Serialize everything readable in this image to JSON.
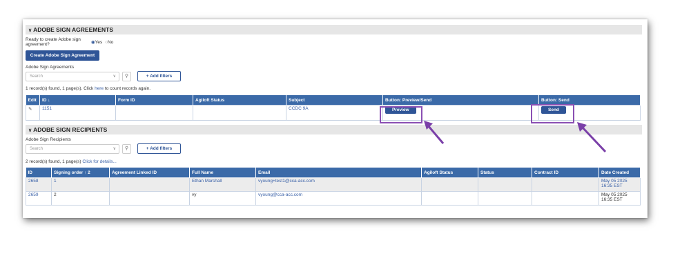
{
  "agreements": {
    "heading": "ADOBE SIGN AGREEMENTS",
    "ready_question": "Ready to create Adobe sign agreement?",
    "ready_options": {
      "yes": "Yes",
      "no": "No"
    },
    "create_button": "Create Adobe Sign Agreement",
    "list_label": "Adobe Sign Agreements",
    "search_placeholder": "Search",
    "add_filters": "+ Add filters",
    "records_text": "1 record(s) found, 1 page(s). Click ",
    "records_link": "here",
    "records_tail": " to count records again.",
    "columns": [
      "Edit",
      "ID ↓",
      "Form ID",
      "Agiloft Status",
      "Subject",
      "Button: Preview/Send",
      "Button: Send"
    ],
    "rows": [
      {
        "id": "1151",
        "form_id": "",
        "status": "",
        "subject": "CCDC 9A",
        "preview": "Preview",
        "send": "Send"
      }
    ]
  },
  "recipients": {
    "heading": "ADOBE SIGN RECIPIENTS",
    "list_label": "Adobe Sign Recipients",
    "search_placeholder": "Search",
    "add_filters": "+ Add filters",
    "records_text": "2 record(s) found, 1 page(s) ",
    "records_link": "Click for details...",
    "columns": [
      "ID",
      "Signing order ↑ 2",
      "Agreement Linked ID",
      "Full Name",
      "Email",
      "Agiloft Status",
      "Status",
      "Contract ID",
      "Date Created"
    ],
    "rows": [
      {
        "id": "2658",
        "order": "1",
        "linked": "",
        "name": "Ethan Marshall",
        "email": "vyoung+test1@cca-acc.com",
        "agstatus": "",
        "status": "",
        "contract": "",
        "date": "May 05 2025 16:35 EST"
      },
      {
        "id": "2659",
        "order": "2",
        "linked": "",
        "name": "vy",
        "email": "vyoung@cca-acc.com",
        "agstatus": "",
        "status": "",
        "contract": "",
        "date": "May 05 2025 16:35 EST"
      }
    ]
  },
  "colors": {
    "accent": "#2f5597",
    "header": "#3b6aa8",
    "highlight": "#8a4fb3"
  }
}
